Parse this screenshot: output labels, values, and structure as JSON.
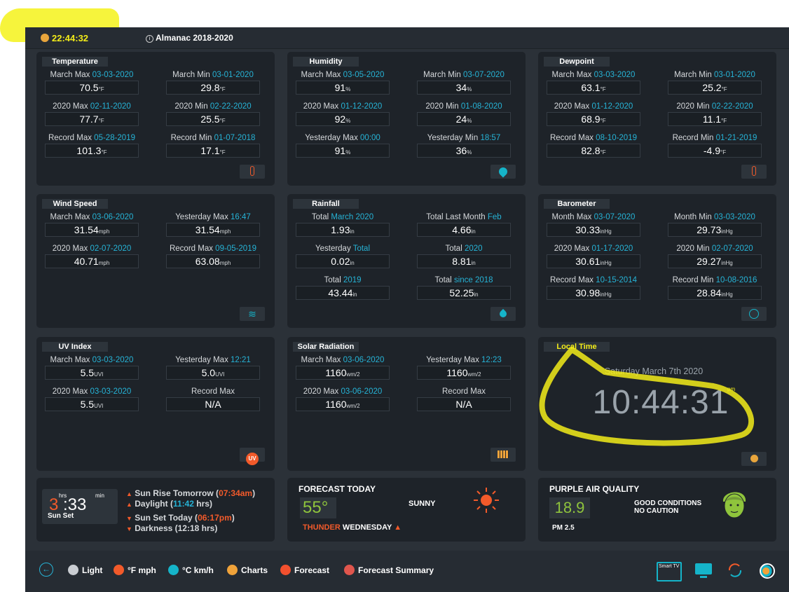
{
  "header": {
    "time": "22:44:32",
    "almanac": "Almanac 2018-2020"
  },
  "temperature": {
    "title": "Temperature",
    "cells": [
      {
        "label": "March Max ",
        "date": "03-03-2020",
        "value": "70.5",
        "unit": "°F"
      },
      {
        "label": "March Min ",
        "date": "03-01-2020",
        "value": "29.8",
        "unit": "°F"
      },
      {
        "label": "2020 Max ",
        "date": "02-11-2020",
        "value": "77.7",
        "unit": "°F"
      },
      {
        "label": "2020 Min ",
        "date": "02-22-2020",
        "value": "25.5",
        "unit": "°F"
      },
      {
        "label": "Record Max ",
        "date": "05-28-2019",
        "value": "101.3",
        "unit": "°F"
      },
      {
        "label": "Record Min ",
        "date": "01-07-2018",
        "value": "17.1",
        "unit": "°F"
      }
    ]
  },
  "humidity": {
    "title": "Humidity",
    "cells": [
      {
        "label": "March Max ",
        "date": "03-05-2020",
        "value": "91",
        "unit": "%"
      },
      {
        "label": "March Min ",
        "date": "03-07-2020",
        "value": "34",
        "unit": "%"
      },
      {
        "label": "2020 Max ",
        "date": "01-12-2020",
        "value": "92",
        "unit": "%"
      },
      {
        "label": "2020 Min ",
        "date": "01-08-2020",
        "value": "24",
        "unit": "%"
      },
      {
        "label": "Yesterday Max ",
        "date": "00:00",
        "value": "91",
        "unit": "%"
      },
      {
        "label": "Yesterday Min ",
        "date": "18:57",
        "value": "36",
        "unit": "%"
      }
    ]
  },
  "dewpoint": {
    "title": "Dewpoint",
    "cells": [
      {
        "label": "March Max ",
        "date": "03-03-2020",
        "value": "63.1",
        "unit": "°F"
      },
      {
        "label": "March Min ",
        "date": "03-01-2020",
        "value": "25.2",
        "unit": "°F"
      },
      {
        "label": "2020 Max ",
        "date": "01-12-2020",
        "value": "68.9",
        "unit": "°F"
      },
      {
        "label": "2020 Min ",
        "date": "02-22-2020",
        "value": "11.1",
        "unit": "°F"
      },
      {
        "label": "Record Max ",
        "date": "08-10-2019",
        "value": "82.8",
        "unit": "°F"
      },
      {
        "label": "Record Min ",
        "date": "01-21-2019",
        "value": "-4.9",
        "unit": "°F"
      }
    ]
  },
  "wind": {
    "title": "Wind Speed",
    "cells": [
      {
        "label": "March Max ",
        "date": "03-06-2020",
        "value": "31.54",
        "unit": "mph"
      },
      {
        "label": "Yesterday Max ",
        "date": "16:47",
        "value": "31.54",
        "unit": "mph"
      },
      {
        "label": "2020 Max ",
        "date": "02-07-2020",
        "value": "40.71",
        "unit": "mph"
      },
      {
        "label": "Record Max ",
        "date": "09-05-2019",
        "value": "63.08",
        "unit": "mph"
      }
    ]
  },
  "rain": {
    "title": "Rainfall",
    "cells": [
      {
        "label": "Total ",
        "date": "March 2020",
        "value": "1.93",
        "unit": "in"
      },
      {
        "label": "Total Last Month ",
        "date": "Feb",
        "value": "4.66",
        "unit": "in"
      },
      {
        "label": "Yesterday ",
        "date": "Total",
        "value": "0.02",
        "unit": "in"
      },
      {
        "label": "Total ",
        "date": "2020",
        "value": "8.81",
        "unit": "in"
      },
      {
        "label": "Total ",
        "date": "2019",
        "value": "43.44",
        "unit": "in"
      },
      {
        "label": "Total ",
        "date": "since 2018",
        "value": "52.25",
        "unit": "in"
      }
    ]
  },
  "baro": {
    "title": "Barometer",
    "cells": [
      {
        "label": "Month Max ",
        "date": "03-07-2020",
        "value": "30.33",
        "unit": "inHg"
      },
      {
        "label": "Month Min ",
        "date": "03-03-2020",
        "value": "29.73",
        "unit": "inHg"
      },
      {
        "label": "2020 Max ",
        "date": "01-17-2020",
        "value": "30.61",
        "unit": "inHg"
      },
      {
        "label": "2020 Min ",
        "date": "02-07-2020",
        "value": "29.27",
        "unit": "inHg"
      },
      {
        "label": "Record Max ",
        "date": "10-15-2014",
        "value": "30.98",
        "unit": "inHg"
      },
      {
        "label": "Record Min ",
        "date": "10-08-2016",
        "value": "28.84",
        "unit": "inHg"
      }
    ]
  },
  "uv": {
    "title": "UV Index",
    "icon_text": "UV",
    "cells": [
      {
        "label": "March Max ",
        "date": "03-03-2020",
        "value": "5.5",
        "unit": "UVI"
      },
      {
        "label": "Yesterday Max ",
        "date": "12:21",
        "value": "5.0",
        "unit": "UVI"
      },
      {
        "label": "2020 Max ",
        "date": "03-03-2020",
        "value": "5.5",
        "unit": "UVI"
      },
      {
        "label": "Record Max",
        "date": "",
        "value": "N/A",
        "unit": ""
      }
    ]
  },
  "solar": {
    "title": "Solar Radiation",
    "cells": [
      {
        "label": "March Max ",
        "date": "03-06-2020",
        "value": "1160",
        "unit": "wm/2"
      },
      {
        "label": "Yesterday Max ",
        "date": "12:23",
        "value": "1160",
        "unit": "wm/2"
      },
      {
        "label": "2020 Max ",
        "date": "03-06-2020",
        "value": "1160",
        "unit": "wm/2"
      },
      {
        "label": "Record Max",
        "date": "",
        "value": "N/A",
        "unit": ""
      }
    ]
  },
  "localtime": {
    "title": "Local Time",
    "date": "Saturday March 7th 2020",
    "time": "10:44:31",
    "ampm": "pm"
  },
  "sun": {
    "hours": "3",
    "hrs": "hrs",
    "minutes": ":33",
    "min": "min",
    "label": "Sun Set",
    "rise_text": "Sun Rise Tomorrow (",
    "rise_time": "07:34am",
    "rise_close": ")",
    "daylight_text": "Daylight (",
    "daylight_time": "11:42",
    "daylight_close": " hrs)",
    "set_text": "Sun Set Today (",
    "set_time": "06:17pm",
    "set_close": ")",
    "darkness": "Darkness (12:18 hrs)"
  },
  "forecast": {
    "title": "FORECAST TODAY",
    "temp": "55°",
    "cond": "SUNNY",
    "alert_red": "THUNDER",
    "alert_day": "WEDNESDAY"
  },
  "air": {
    "title": "PURPLE AIR QUALITY",
    "value": "18.9",
    "cond1": "GOOD CONDITIONS",
    "cond2": "NO CAUTION",
    "label": "PM 2.5"
  },
  "legend": {
    "items": [
      {
        "label": "Light",
        "color": "#c9cdd2"
      },
      {
        "label": "°F mph",
        "color": "#f25a2a"
      },
      {
        "label": "°C km/h",
        "color": "#15b4c9"
      },
      {
        "label": "Charts",
        "color": "#f0a33a"
      },
      {
        "label": "Forecast",
        "color": "#f2502e"
      },
      {
        "label": "Forecast Summary",
        "color": "#e0564d"
      }
    ],
    "tv_text": "Smart TV"
  },
  "colors": {
    "accent": "#26b3d6",
    "yellow": "#f3ec19",
    "orange": "#f25a2a",
    "green": "#8fc43c"
  }
}
